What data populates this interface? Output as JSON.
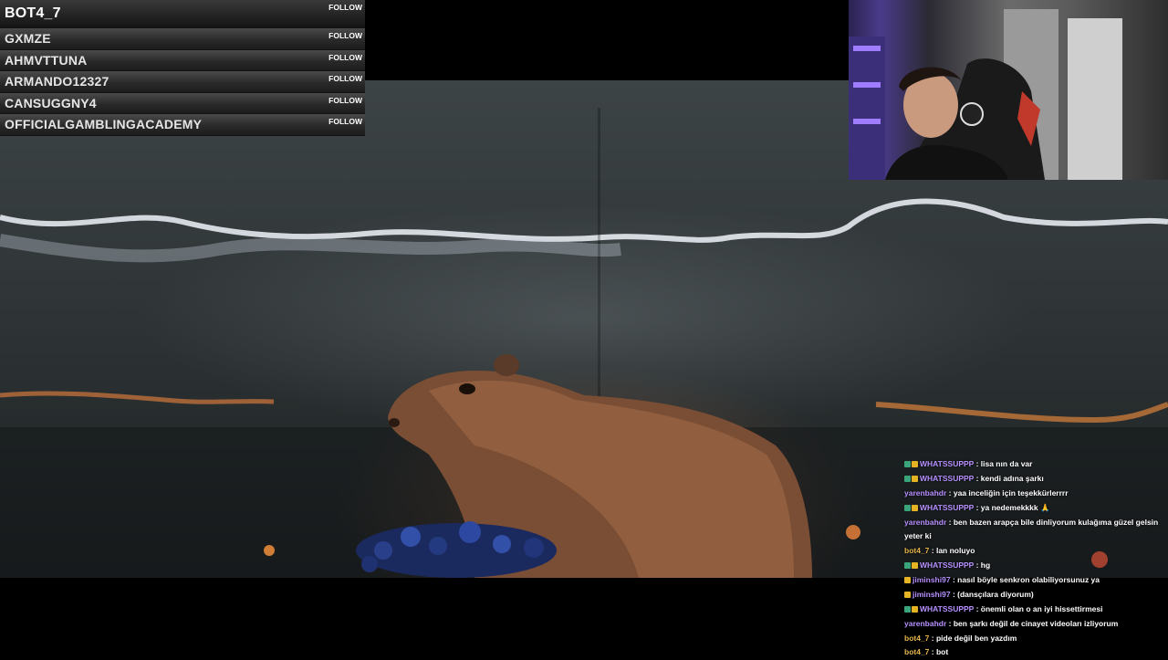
{
  "followers": [
    {
      "name": "BOT4_7",
      "button": "FOLLOW"
    },
    {
      "name": "GXMZE",
      "button": "FOLLOW"
    },
    {
      "name": "AHMVTTUNA",
      "button": "FOLLOW"
    },
    {
      "name": "ARMANDO12327",
      "button": "FOLLOW"
    },
    {
      "name": "CANSUGGNY4",
      "button": "FOLLOW"
    },
    {
      "name": "OFFICIALGAMBLINGACADEMY",
      "button": "FOLLOW"
    }
  ],
  "colors": {
    "purple_user": "#b690ff",
    "yellow_user": "#e4b34a"
  },
  "chat": [
    {
      "user": "WHATSSUPPP",
      "color": "#b690ff",
      "badges": [
        "mod",
        "crown"
      ],
      "text": "lisa nın da var"
    },
    {
      "user": "WHATSSUPPP",
      "color": "#b690ff",
      "badges": [
        "mod",
        "crown"
      ],
      "text": "kendi adına şarkı"
    },
    {
      "user": "yarenbahdr",
      "color": "#b690ff",
      "badges": [],
      "text": "yaa inceliğin için teşekkürlerrrr"
    },
    {
      "user": "WHATSSUPPP",
      "color": "#b690ff",
      "badges": [
        "mod",
        "crown"
      ],
      "text": "ya nedemekkkk 🙏"
    },
    {
      "user": "yarenbahdr",
      "color": "#b690ff",
      "badges": [],
      "text": "ben bazen arapça bile dinliyorum kulağıma güzel gelsin yeter ki"
    },
    {
      "user": "bot4_7",
      "color": "#e4b34a",
      "badges": [],
      "text": "lan noluyo"
    },
    {
      "user": "WHATSSUPPP",
      "color": "#b690ff",
      "badges": [
        "mod",
        "crown"
      ],
      "text": "hg"
    },
    {
      "user": "jiminshi97",
      "color": "#b690ff",
      "badges": [
        "crown"
      ],
      "text": "nasıl böyle senkron olabiliyorsunuz ya"
    },
    {
      "user": "jiminshi97",
      "color": "#b690ff",
      "badges": [
        "crown"
      ],
      "text": "(dansçılara diyorum)"
    },
    {
      "user": "WHATSSUPPP",
      "color": "#b690ff",
      "badges": [
        "mod",
        "crown"
      ],
      "text": "önemli olan o an iyi hissettirmesi"
    },
    {
      "user": "yarenbahdr",
      "color": "#b690ff",
      "badges": [],
      "text": "ben şarkı değil de cinayet videoları izliyorum"
    },
    {
      "user": "bot4_7",
      "color": "#e4b34a",
      "badges": [],
      "text": "pide değil ben yazdım"
    },
    {
      "user": "bot4_7",
      "color": "#e4b34a",
      "badges": [],
      "text": "bot"
    }
  ]
}
